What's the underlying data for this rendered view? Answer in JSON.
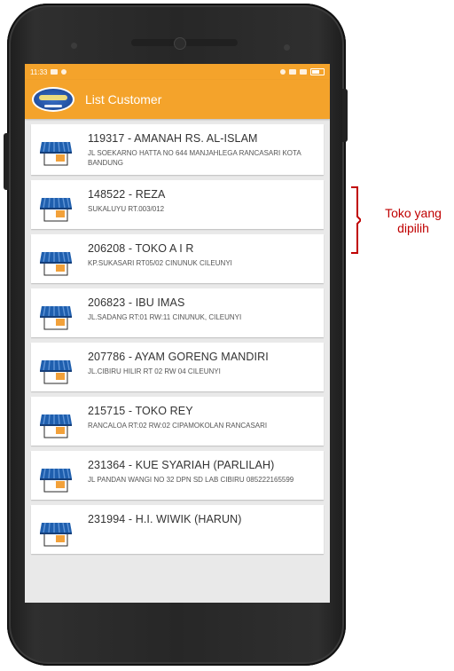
{
  "status_bar": {
    "time": "11:33"
  },
  "app": {
    "title": "List Customer"
  },
  "customers": [
    {
      "title": "119317 - AMANAH RS. AL-ISLAM",
      "address": "JL SOEKARNO HATTA NO 644 MANJAHLEGA RANCASARI KOTA BANDUNG"
    },
    {
      "title": "148522 - REZA",
      "address": "SUKALUYU RT.003/012"
    },
    {
      "title": "206208 - TOKO A I R",
      "address": "KP.SUKASARI RT05/02 CINUNUK CILEUNYI"
    },
    {
      "title": "206823 - IBU IMAS",
      "address": "JL.SADANG RT:01 RW:11 CINUNUK, CILEUNYI"
    },
    {
      "title": "207786 - AYAM GORENG MANDIRI",
      "address": "JL.CIBIRU HILIR RT 02 RW 04 CILEUNYI"
    },
    {
      "title": "215715 - TOKO REY",
      "address": "RANCALOA RT:02 RW:02 CIPAMOKOLAN RANCASARI"
    },
    {
      "title": "231364 - KUE SYARIAH (PARLILAH)",
      "address": "JL PANDAN WANGI NO 32 DPN SD LAB CIBIRU 085222165599"
    },
    {
      "title": "231994 - H.I. WIWIK (HARUN)",
      "address": ""
    }
  ],
  "annotation": {
    "line1": "Toko yang",
    "line2": "dipilih"
  },
  "colors": {
    "accent": "#f4a32b",
    "annotation": "#c00000",
    "awning": "#1f5fae"
  }
}
